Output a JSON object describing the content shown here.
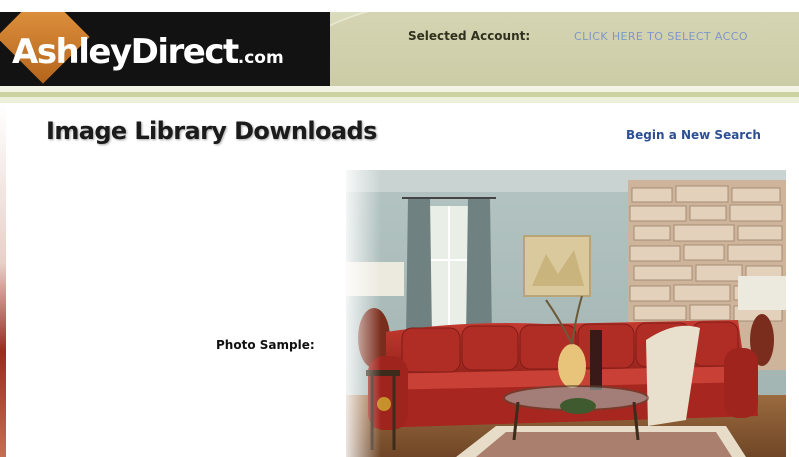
{
  "header": {
    "logo_main": "AshleyDirect",
    "logo_suffix": ".com",
    "account_label": "Selected Account:",
    "account_link": "CLICK HERE TO SELECT ACCO"
  },
  "main": {
    "title": "Image Library Downloads",
    "new_search_link": "Begin a New Search",
    "photo_label": "Photo Sample:"
  },
  "colors": {
    "header_band": "#c9c9a4",
    "logo_bg": "#121212",
    "logo_accent": "#d98a38",
    "link_blue": "#2f4f93",
    "sofa_red": "#b8322a"
  }
}
